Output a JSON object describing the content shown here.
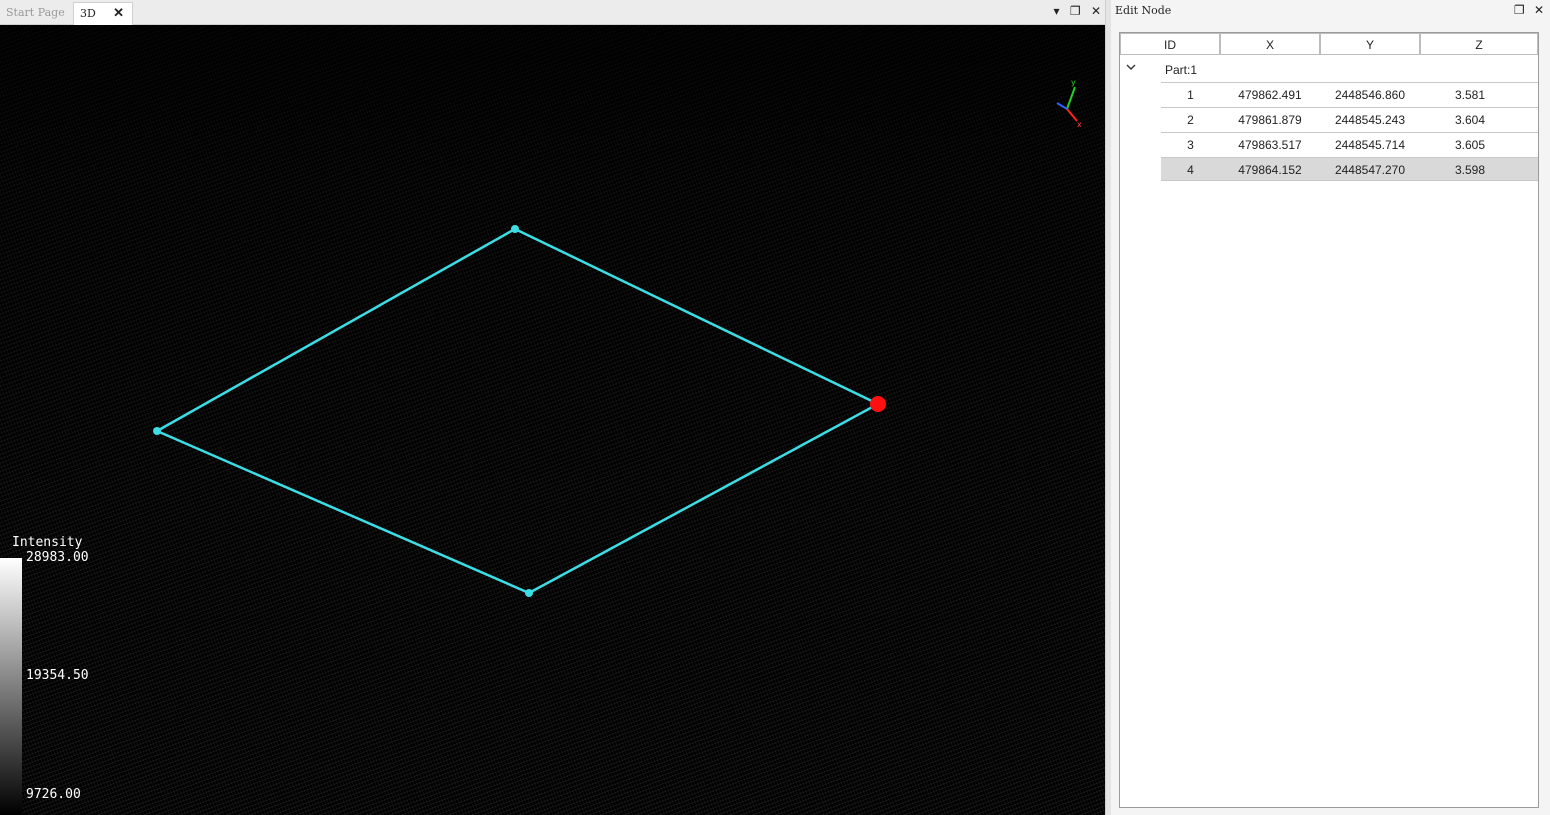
{
  "tabs": {
    "start_label": "Start Page",
    "active_label": "3D",
    "close_glyph": "✕"
  },
  "window_controls": {
    "dropdown_glyph": "▾",
    "restore_glyph": "❐",
    "close_glyph": "✕"
  },
  "viewport": {
    "scalebar": {
      "title": "Intensity",
      "max": "28983.00",
      "mid": "19354.50",
      "min": "9726.00"
    },
    "axes": {
      "x": "x",
      "y": "y"
    },
    "polygon_color": "#3cdde4",
    "selected_node_color": "#ff1010"
  },
  "panel": {
    "title": "Edit Node",
    "restore_glyph": "❐",
    "close_glyph": "✕",
    "columns": [
      "ID",
      "X",
      "Y",
      "Z"
    ],
    "group": {
      "label": "Part:1",
      "expanded": true
    },
    "rows": [
      {
        "id": "1",
        "x": "479862.491",
        "y": "2448546.860",
        "z": "3.581"
      },
      {
        "id": "2",
        "x": "479861.879",
        "y": "2448545.243",
        "z": "3.604"
      },
      {
        "id": "3",
        "x": "479863.517",
        "y": "2448545.714",
        "z": "3.605"
      },
      {
        "id": "4",
        "x": "479864.152",
        "y": "2448547.270",
        "z": "3.598"
      }
    ],
    "selected_row": "4"
  }
}
